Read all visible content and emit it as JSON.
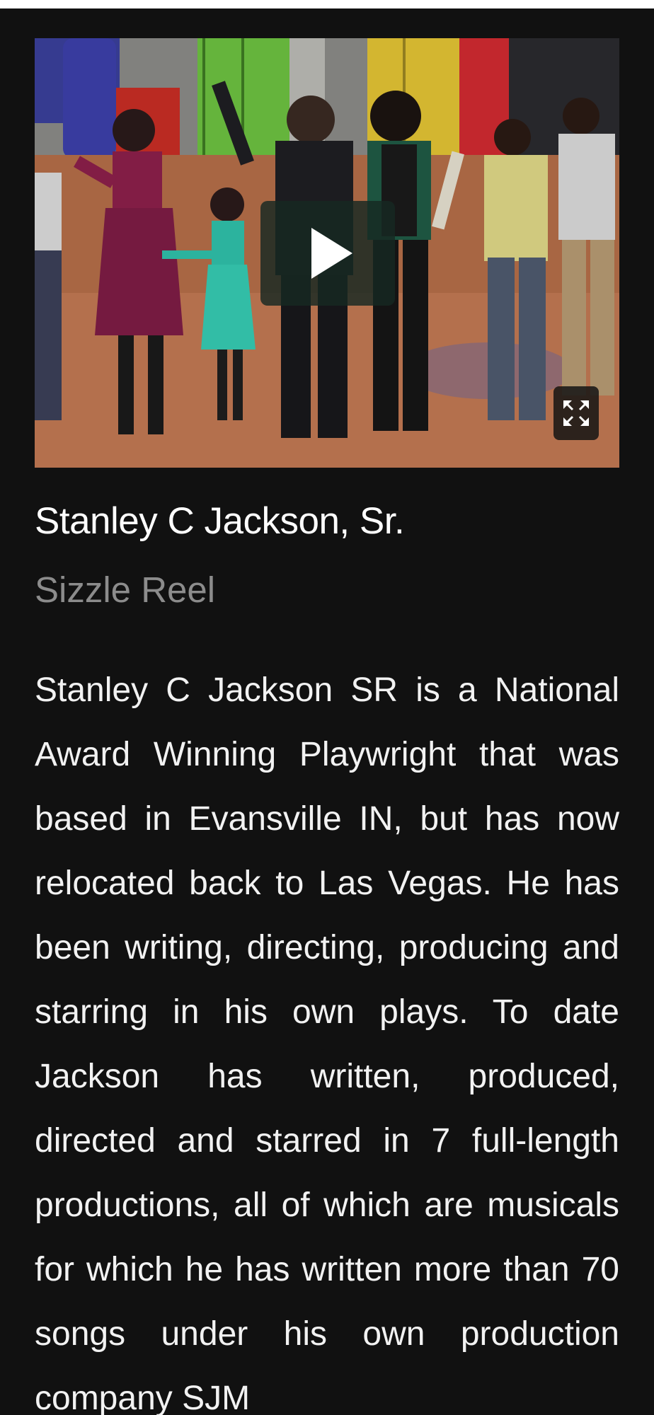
{
  "video": {
    "play_icon": "play-icon",
    "fullscreen_icon": "fullscreen-icon"
  },
  "profile": {
    "name": "Stanley C Jackson, Sr.",
    "subtitle": "Sizzle Reel",
    "description": "Stanley C Jackson SR is a National Award Winning Playwright that was based in Evansville IN, but has now relocated back to Las Vegas. He has been writing, directing, producing and starring in his own plays. To date Jackson has written, produced, directed and starred in 7 full-length productions, all of which are musicals for which he has written more than 70 songs under his own production company SJM"
  },
  "colors": {
    "background": "#111111",
    "title": "#ffffff",
    "subtitle": "#8c8c8c",
    "text": "#f2f2f2"
  }
}
